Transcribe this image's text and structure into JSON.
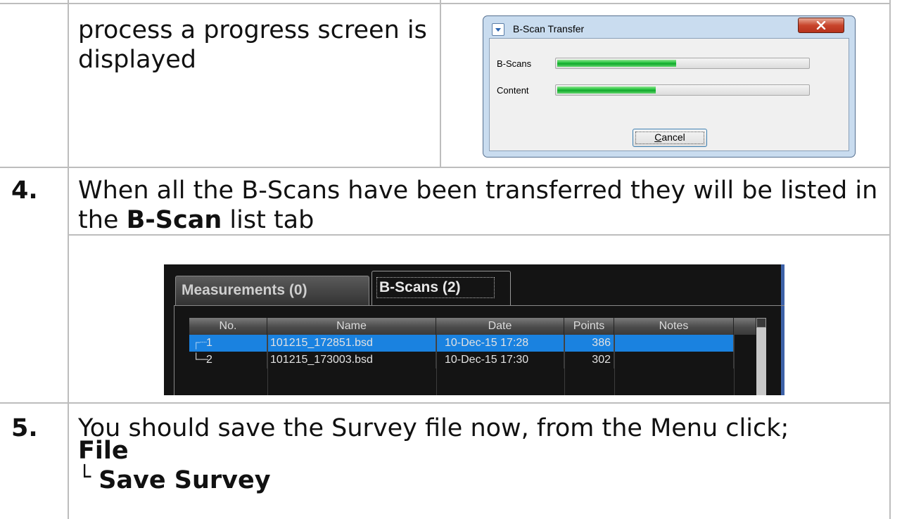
{
  "step3": {
    "text": "process a progress screen is displayed"
  },
  "dialog": {
    "title": "B-Scan Transfer",
    "close_label": "x",
    "app_icon": "dialog-app-icon",
    "rows": [
      {
        "label": "B-Scans",
        "progress": 0.48
      },
      {
        "label": "Content",
        "progress": 0.4
      }
    ],
    "cancel_mnemonic": "C",
    "cancel_rest": "ancel",
    "fill_color": "#12a52c"
  },
  "step4": {
    "number": "4.",
    "text_before": "When all the B-Scans have been transferred they will be listed in the ",
    "bold": "B-Scan",
    "text_after": " list tab"
  },
  "panel": {
    "tabs": [
      "Measurements (0)",
      "B-Scans (2)"
    ],
    "active_tab": "B-Scans (2)",
    "columns": [
      "No.",
      "Name",
      "Date",
      "Points",
      "Notes"
    ],
    "rows": [
      {
        "no": "1",
        "name": "101215_172851.bsd",
        "date": "10-Dec-15 17:28",
        "points": "386",
        "notes": "",
        "selected": true
      },
      {
        "no": "2",
        "name": "101215_173003.bsd",
        "date": "10-Dec-15 17:30",
        "points": "302",
        "notes": "",
        "selected": false
      }
    ],
    "tree_glyphs": [
      "┌┈",
      "└─"
    ],
    "selection_color": "#1a82e0"
  },
  "step5": {
    "number": "5.",
    "text": "You should save the Survey file now, from the Menu click;",
    "menu_1": "File",
    "menu_prefix": "└",
    "menu_2": "Save Survey"
  }
}
